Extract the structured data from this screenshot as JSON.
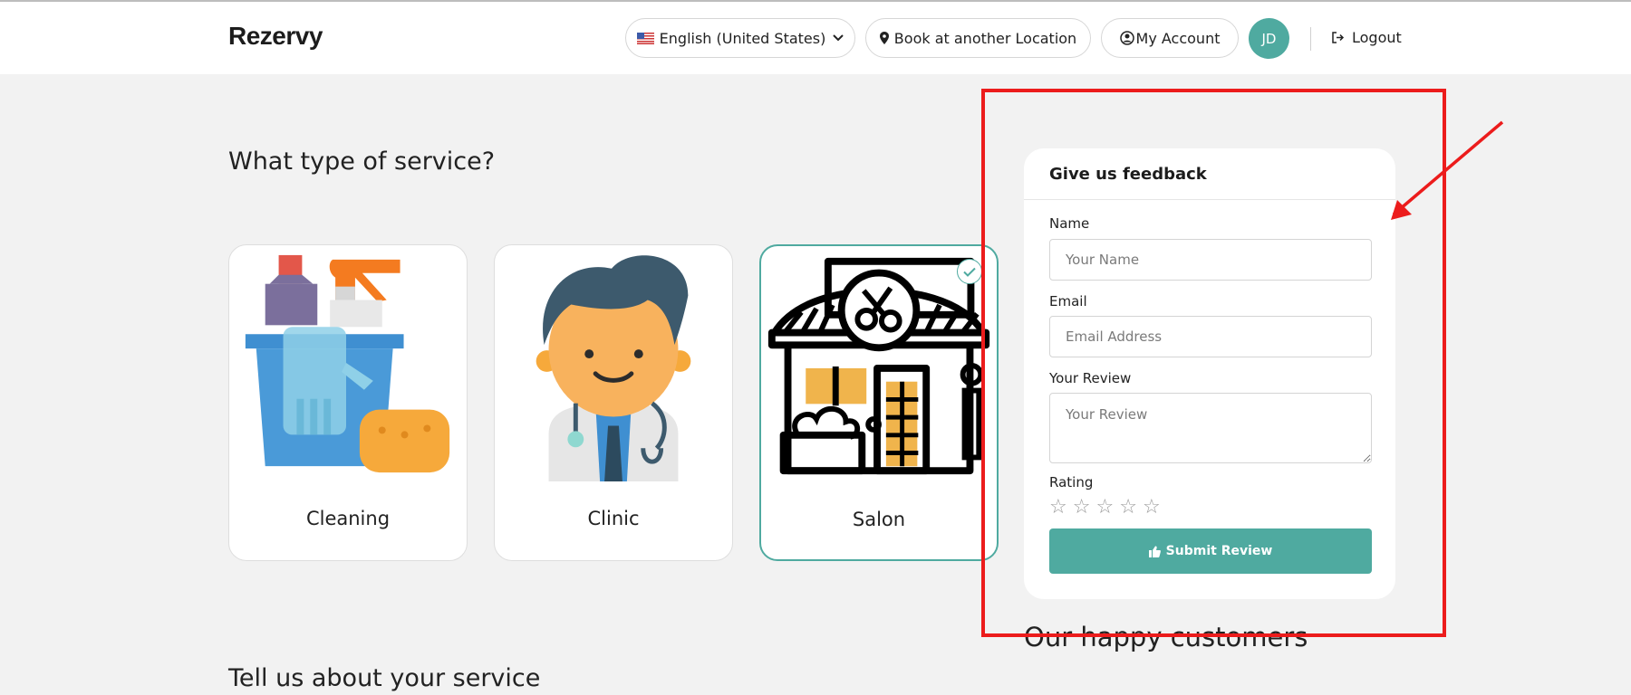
{
  "header": {
    "logo": "Rezervy",
    "language": "English (United States)",
    "book_location": "Book at another Location",
    "my_account": "My Account",
    "avatar_initials": "JD",
    "logout": "Logout"
  },
  "main": {
    "service_heading": "What type of service?",
    "services": [
      {
        "label": "Cleaning",
        "selected": false
      },
      {
        "label": "Clinic",
        "selected": false
      },
      {
        "label": "Salon",
        "selected": true
      }
    ],
    "tell_heading": "Tell us about your service",
    "happy_heading": "Our happy customers"
  },
  "feedback": {
    "title": "Give us feedback",
    "name_label": "Name",
    "name_placeholder": "Your Name",
    "email_label": "Email",
    "email_placeholder": "Email Address",
    "review_label": "Your Review",
    "review_placeholder": "Your Review",
    "rating_label": "Rating",
    "rating_value": 0,
    "rating_max": 5,
    "submit_label": "Submit Review"
  },
  "colors": {
    "accent": "#4faaa0",
    "annotation": "#ec1c1c"
  }
}
